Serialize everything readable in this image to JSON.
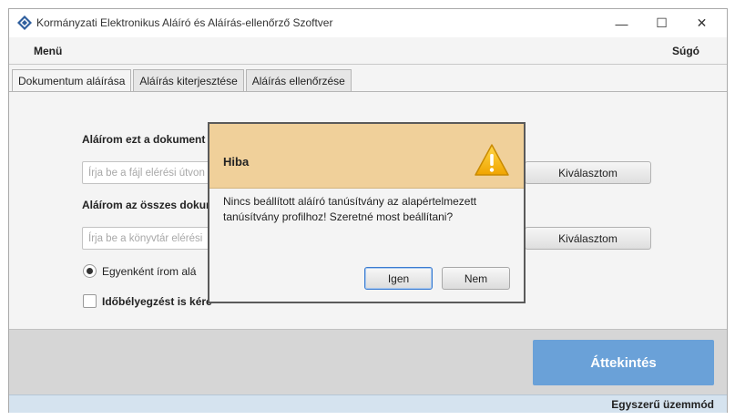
{
  "window": {
    "title": "Kormányzati Elektronikus Aláíró és Aláírás-ellenőrző Szoftver",
    "controls": {
      "minimize": "—",
      "maximize": "☐",
      "close": "✕"
    }
  },
  "menu": {
    "left": "Menü",
    "right": "Súgó"
  },
  "tabs": [
    {
      "label": "Dokumentum aláírása",
      "active": true
    },
    {
      "label": "Aláírás kiterjesztése",
      "active": false
    },
    {
      "label": "Aláírás ellenőrzése",
      "active": false
    }
  ],
  "form": {
    "single_doc_label": "Aláírom ezt a dokument",
    "single_doc_placeholder": "Írja be a fájl elérési útvon",
    "single_doc_button": "Kiválasztom",
    "all_docs_label": "Aláírom az összes dokum",
    "all_docs_placeholder": "Írja be a könyvtár elérési",
    "all_docs_button": "Kiválasztom",
    "radio_label": "Egyenként írom alá",
    "checkbox_label": "Időbélyegzést is kére"
  },
  "bottom": {
    "review_button": "Áttekintés"
  },
  "status": {
    "mode": "Egyszerű üzemmód"
  },
  "dialog": {
    "title": "Hiba",
    "message": "Nincs beállított aláíró tanúsítvány az alapértelmezett tanúsítvány profilhoz! Szeretné most beállítani?",
    "yes_button": "Igen",
    "no_button": "Nem",
    "icon": "warning-icon"
  },
  "colors": {
    "dialog_header": "#f0d09a",
    "primary_button": "#6aa1d8",
    "status_bar": "#d5e3ef",
    "warning": "#f5b800"
  }
}
